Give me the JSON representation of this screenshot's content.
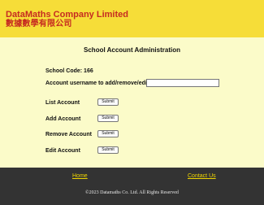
{
  "header": {
    "brand_en": "DataMaths Company Limited",
    "brand_zh": "數據數學有限公司"
  },
  "main": {
    "title": "School Account Administration",
    "school_code": "School Code: 166",
    "username_label": "Account username to add/remove/edit",
    "username_value": "",
    "actions": [
      {
        "label": "List Account",
        "button": "Submit"
      },
      {
        "label": "Add Account",
        "button": "Submit"
      },
      {
        "label": "Remove Account",
        "button": "Submit"
      },
      {
        "label": "Edit Account",
        "button": "Submit"
      }
    ]
  },
  "footer": {
    "home": "Home",
    "contact": "Contact Us",
    "copyright": "©2023 Datamaths Co. Ltd.    All Rights Reserved"
  },
  "colors": {
    "header_bg": "#f6dd38",
    "brand_text": "#c62b21",
    "content_bg": "#fbfbc9",
    "footer_bg": "#333333",
    "footer_link": "#f0d600"
  }
}
